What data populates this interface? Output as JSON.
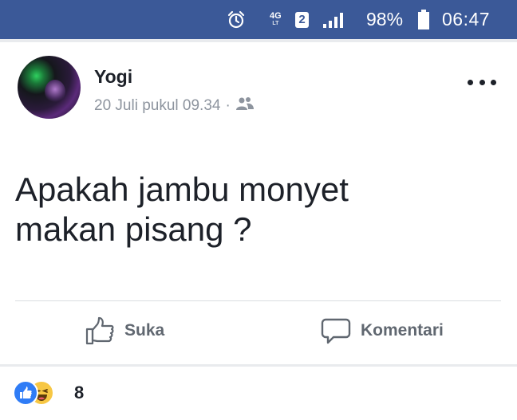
{
  "status_bar": {
    "network": "4G",
    "network_sub": "LT",
    "sim_slot": "2",
    "battery": "98%",
    "time": "06:47",
    "background_color": "#3b5998",
    "icons": [
      "alarm-icon",
      "signal-icon",
      "battery-icon"
    ]
  },
  "post": {
    "author": "Yogi",
    "date": "20 Juli pukul 09.34",
    "separator": "·",
    "audience_icon": "friends-icon",
    "text_line1": "Apakah jambu monyet",
    "text_line2": "makan pisang ?",
    "more_icon": "more-options-icon"
  },
  "actions": {
    "like_label": "Suka",
    "comment_label": "Komentari"
  },
  "reactions": {
    "icons": [
      "like-reaction-icon",
      "haha-reaction-icon"
    ],
    "count": "8"
  }
}
